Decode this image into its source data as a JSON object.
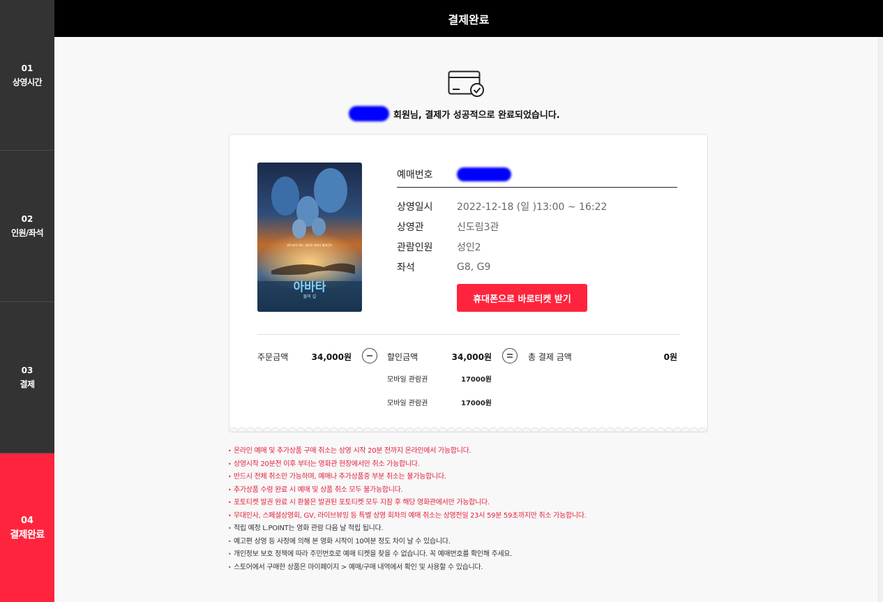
{
  "header": {
    "title": "결제완료"
  },
  "steps": [
    {
      "num": "01",
      "label": "상영시간"
    },
    {
      "num": "02",
      "label": "인원/좌석"
    },
    {
      "num": "03",
      "label": "결제"
    },
    {
      "num": "04",
      "label": "결제완료"
    }
  ],
  "message": {
    "text": "회원님, 결제가 성공적으로 완료되었습니다."
  },
  "booking": {
    "reservation_label": "예매번호",
    "rows": [
      {
        "label": "상영일시",
        "value": "2022-12-18 (일 )13:00 ~ 16:22"
      },
      {
        "label": "상영관",
        "value": "신도림3관"
      },
      {
        "label": "관람인원",
        "value": "성인2"
      },
      {
        "label": "좌석",
        "value": "G8, G9"
      }
    ],
    "mobile_ticket_button": "휴대폰으로 바로티켓 받기"
  },
  "poster": {
    "title": "아바타",
    "subtitle": "물의 길",
    "tagline": "판도라의 바다, 새로운 세계가 펼쳐진다"
  },
  "payment": {
    "order_label": "주문금액",
    "order_amount": "34,000원",
    "minus_icon": "minus-circle-icon",
    "discount_label": "할인금액",
    "discount_amount": "34,000원",
    "discount_items": [
      {
        "label": "모바일 관람권",
        "amount": "17000원"
      },
      {
        "label": "모바일 관람권",
        "amount": "17000원"
      }
    ],
    "equals_icon": "equals-circle-icon",
    "total_label": "총 결제 금액",
    "total_amount": "0원"
  },
  "notices": [
    {
      "text": "온라인 예매 및 추가상품 구매 취소는 상영 시작 20분 전까지 온라인에서 가능합니다.",
      "color": "#e3213c"
    },
    {
      "text": "상영시작 20분전 이후 부터는 영화관 현장에서만 취소 가능합니다.",
      "color": "#e3213c"
    },
    {
      "text": "반드시 전체 취소만 가능하며, 예매나 추가상품중 부분 취소는 불가능합니다.",
      "color": "#e3213c"
    },
    {
      "text": "추가상품 수령 완료 시 예매 및 상품 취소 모두 불가능합니다.",
      "color": "#e3213c"
    },
    {
      "text": "포토티켓 발권 완료 시 환불은 발권된 포토티켓 모두 지참 후 해당 영화관에서만 가능합니다.",
      "color": "#e3213c"
    },
    {
      "text": "무대인사, 스페셜상영회, GV, 라이브뷰잉 등 특별 상영 회차의 예매 취소는 상영전일 23시 59분 59초까지만 취소 가능합니다.",
      "color": "#e3213c"
    },
    {
      "text": "적립 예정 L.POINT는 영화 관람 다음 날 적립 됩니다.",
      "color": "#333333"
    },
    {
      "text": "예고편 상영 등 사정에 의해 본 영화 시작이 10여분 정도 차이 날 수 있습니다.",
      "color": "#333333"
    },
    {
      "text": "개인정보 보호 정책에 따라 주민번호로 예매 티켓을 찾을 수 없습니다. 꼭 예매번호를 확인해 주세요.",
      "color": "#333333"
    },
    {
      "text": "스토어에서 구매한 상품은 마이페이지 > 예매/구매 내역에서 확인 및 사용할 수 있습니다.",
      "color": "#333333"
    }
  ],
  "colors": {
    "accent": "#ff243e",
    "sidebar": "#333333",
    "topbar": "#000000"
  }
}
